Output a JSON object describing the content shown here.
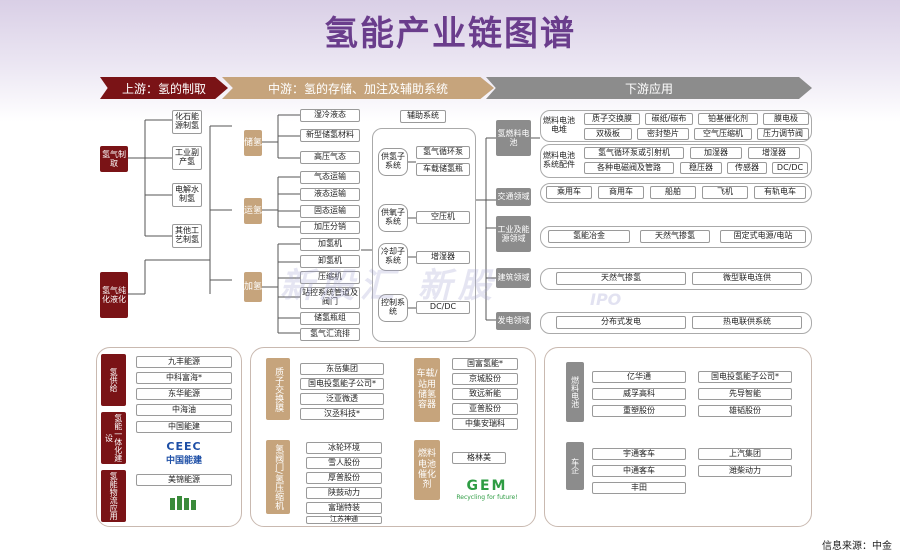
{
  "title": "氢能产业链图谱",
  "stages": {
    "up": "上游：氢的制取",
    "mid": "中游：氢的存储、加注及辅助系统",
    "down": "下游应用"
  },
  "upstream": {
    "prod": "氢气制取",
    "pur": "氢气纯化液化",
    "methods": [
      "化石能源制氢",
      "工业副产氢",
      "电解水制氢",
      "其他工艺制氢"
    ]
  },
  "midstream": {
    "store": "储氢",
    "trans": "运氢",
    "fill": "加氢",
    "store_items": [
      "湿冷液态",
      "新型储氢材料",
      "高压气态"
    ],
    "trans_items": [
      "气态运输",
      "液态运输",
      "固态运输",
      "加压分销"
    ],
    "fill_items": [
      "加氢机",
      "卸氢机",
      "压缩机",
      "站控系统管道及阀门",
      "储氢瓶组",
      "氢气汇流排"
    ],
    "aux": "辅助系统",
    "aux_sys": [
      "供氢子系统",
      "供氧子系统",
      "冷却子系统",
      "控制系统"
    ],
    "aux_items": [
      "氢气循环泵",
      "车载储氢瓶",
      "空压机",
      "增湿器",
      "DC/DC"
    ]
  },
  "downstream": {
    "fc": "氢燃料电池",
    "stack": "燃料电池电堆",
    "bop": "燃料电池系统配件",
    "stack_items": [
      "质子交换膜",
      "碳纸/碳布",
      "铂基催化剂",
      "膜电极",
      "双极板",
      "密封垫片",
      "空气压缩机",
      "压力调节阀"
    ],
    "bop_items": [
      "氢气循环泵或引射机",
      "加湿器",
      "增湿器",
      "各种电磁阀及管路",
      "稳压器",
      "传感器",
      "DC/DC"
    ],
    "transport": "交通领域",
    "transport_items": [
      "乘用车",
      "商用车",
      "船舶",
      "飞机",
      "有轨电车"
    ],
    "industry": "工业及能源领域",
    "industry_items": [
      "氢能冶金",
      "天然气掺氢",
      "固定式电源/电站"
    ],
    "building": "建筑领域",
    "building_items": [
      "天然气掺氢",
      "微型联电连供"
    ],
    "power": "发电领域",
    "power_items": [
      "分布式发电",
      "热电联供系统"
    ]
  },
  "companies": {
    "supply": "氢供给",
    "supply_list": [
      "九丰能源",
      "中科富海*",
      "东华能源",
      "中海油"
    ],
    "integrated": "氢能一体化建设",
    "integrated_list": [
      "中国能建"
    ],
    "ceec_logo": "中国能建",
    "ceec_mark": "CEEC",
    "logistics": "氢能物流应用",
    "logistics_list": [
      "美锦能源"
    ],
    "pem": "质子交换膜",
    "pem_list": [
      "东岳集团",
      "国电投氢能子公司*",
      "泛亚微透",
      "汉丞科技*"
    ],
    "valve": "氢阀门/氢压缩机",
    "valve_list": [
      "冰轮环境",
      "雪人股份",
      "厚普股份",
      "陕鼓动力",
      "富瑞特装",
      "江苏神通"
    ],
    "tank": "车载/站用储氢容器",
    "tank_list": [
      "国富氢能*",
      "京城股份",
      "致远新能",
      "亚普股份",
      "中集安瑞科"
    ],
    "catalyst": "燃料电池催化剂",
    "catalyst_list": [
      "格林美"
    ],
    "gem_logo": "GEM",
    "gem_sub": "Recycling for future!",
    "fcell": "燃料电池",
    "fcell_list": [
      "亿华通",
      "国电投氢能子公司*",
      "威孚高科",
      "先导智能",
      "重塑股份",
      "雄韬股份"
    ],
    "vehicle": "车企",
    "vehicle_list": [
      "宇通客车",
      "上汽集团",
      "中通客车",
      "潍柴动力",
      "丰田"
    ]
  },
  "watermark": "新股汇 新股",
  "watermark_sub": "IPO",
  "source": "信息来源：中金"
}
